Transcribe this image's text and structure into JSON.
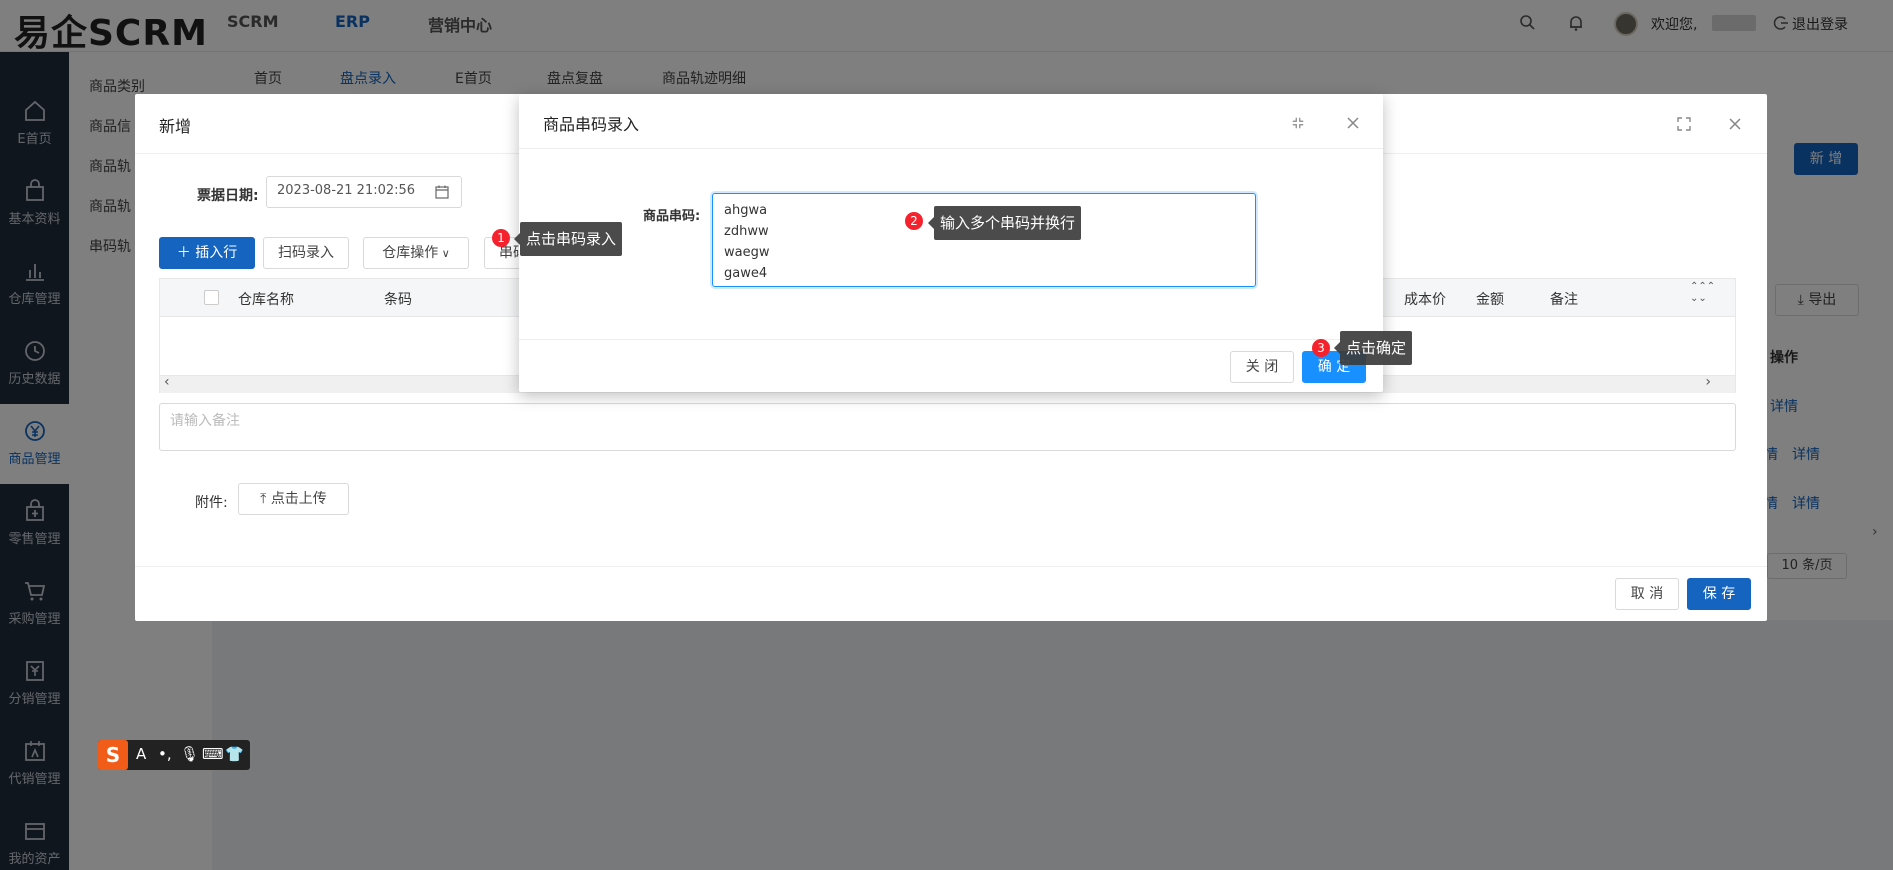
{
  "app": {
    "logo": "易企SCRM",
    "top_nav": [
      "SCRM",
      "ERP",
      "营销中心"
    ],
    "welcome": "欢迎您,",
    "logout": "退出登录"
  },
  "sidebar": {
    "items": [
      {
        "label": "E首页",
        "icon": "home-icon"
      },
      {
        "label": "基本资料",
        "icon": "bag-icon"
      },
      {
        "label": "仓库管理",
        "icon": "chart-icon"
      },
      {
        "label": "历史数据",
        "icon": "clock-icon"
      },
      {
        "label": "商品管理",
        "icon": "yen-icon"
      },
      {
        "label": "零售管理",
        "icon": "shop-icon"
      },
      {
        "label": "采购管理",
        "icon": "cart-icon"
      },
      {
        "label": "分销管理",
        "icon": "yen-doc-icon"
      },
      {
        "label": "代销管理",
        "icon": "calendar-icon"
      },
      {
        "label": "我的资产",
        "icon": "wallet-icon"
      }
    ]
  },
  "submenu": {
    "items": [
      "商品类别",
      "商品信",
      "商品轨",
      "商品轨",
      "串码轨"
    ]
  },
  "tabs": [
    "首页",
    "盘点录入",
    "E首页",
    "盘点复盘",
    "商品轨迹明细"
  ],
  "background": {
    "add_button": "新 增",
    "export_button": "导出",
    "column_actions": "操作",
    "links": [
      "详情",
      "详情",
      "详情"
    ],
    "links_prefix": [
      "情",
      "情"
    ],
    "page_size": "10 条/页"
  },
  "add_dialog": {
    "title": "新增",
    "date_label": "票据日期:",
    "date_value": "2023-08-21 21:02:56",
    "btn_insert": "插入行",
    "btn_scan": "扫码录入",
    "btn_warehouse": "仓库操作",
    "btn_serial_partial": "串码",
    "columns": [
      "仓库名称",
      "条码",
      "成本价",
      "金额",
      "备注"
    ],
    "note_placeholder": "请输入备注",
    "attachment_label": "附件:",
    "upload_button": "点击上传",
    "cancel": "取 消",
    "save": "保 存"
  },
  "serial_dialog": {
    "title": "商品串码录入",
    "field_label": "商品串码:",
    "lines": [
      "ahgwa",
      "zdhww",
      "waegw",
      "gawe4"
    ],
    "close": "关 闭",
    "confirm": "确 定"
  },
  "tips": [
    {
      "num": "1",
      "text": "点击串码录入"
    },
    {
      "num": "2",
      "text": "输入多个串码并换行"
    },
    {
      "num": "3",
      "text": "点击确定"
    }
  ],
  "ime": {
    "letter": "A",
    "logo": "S"
  }
}
